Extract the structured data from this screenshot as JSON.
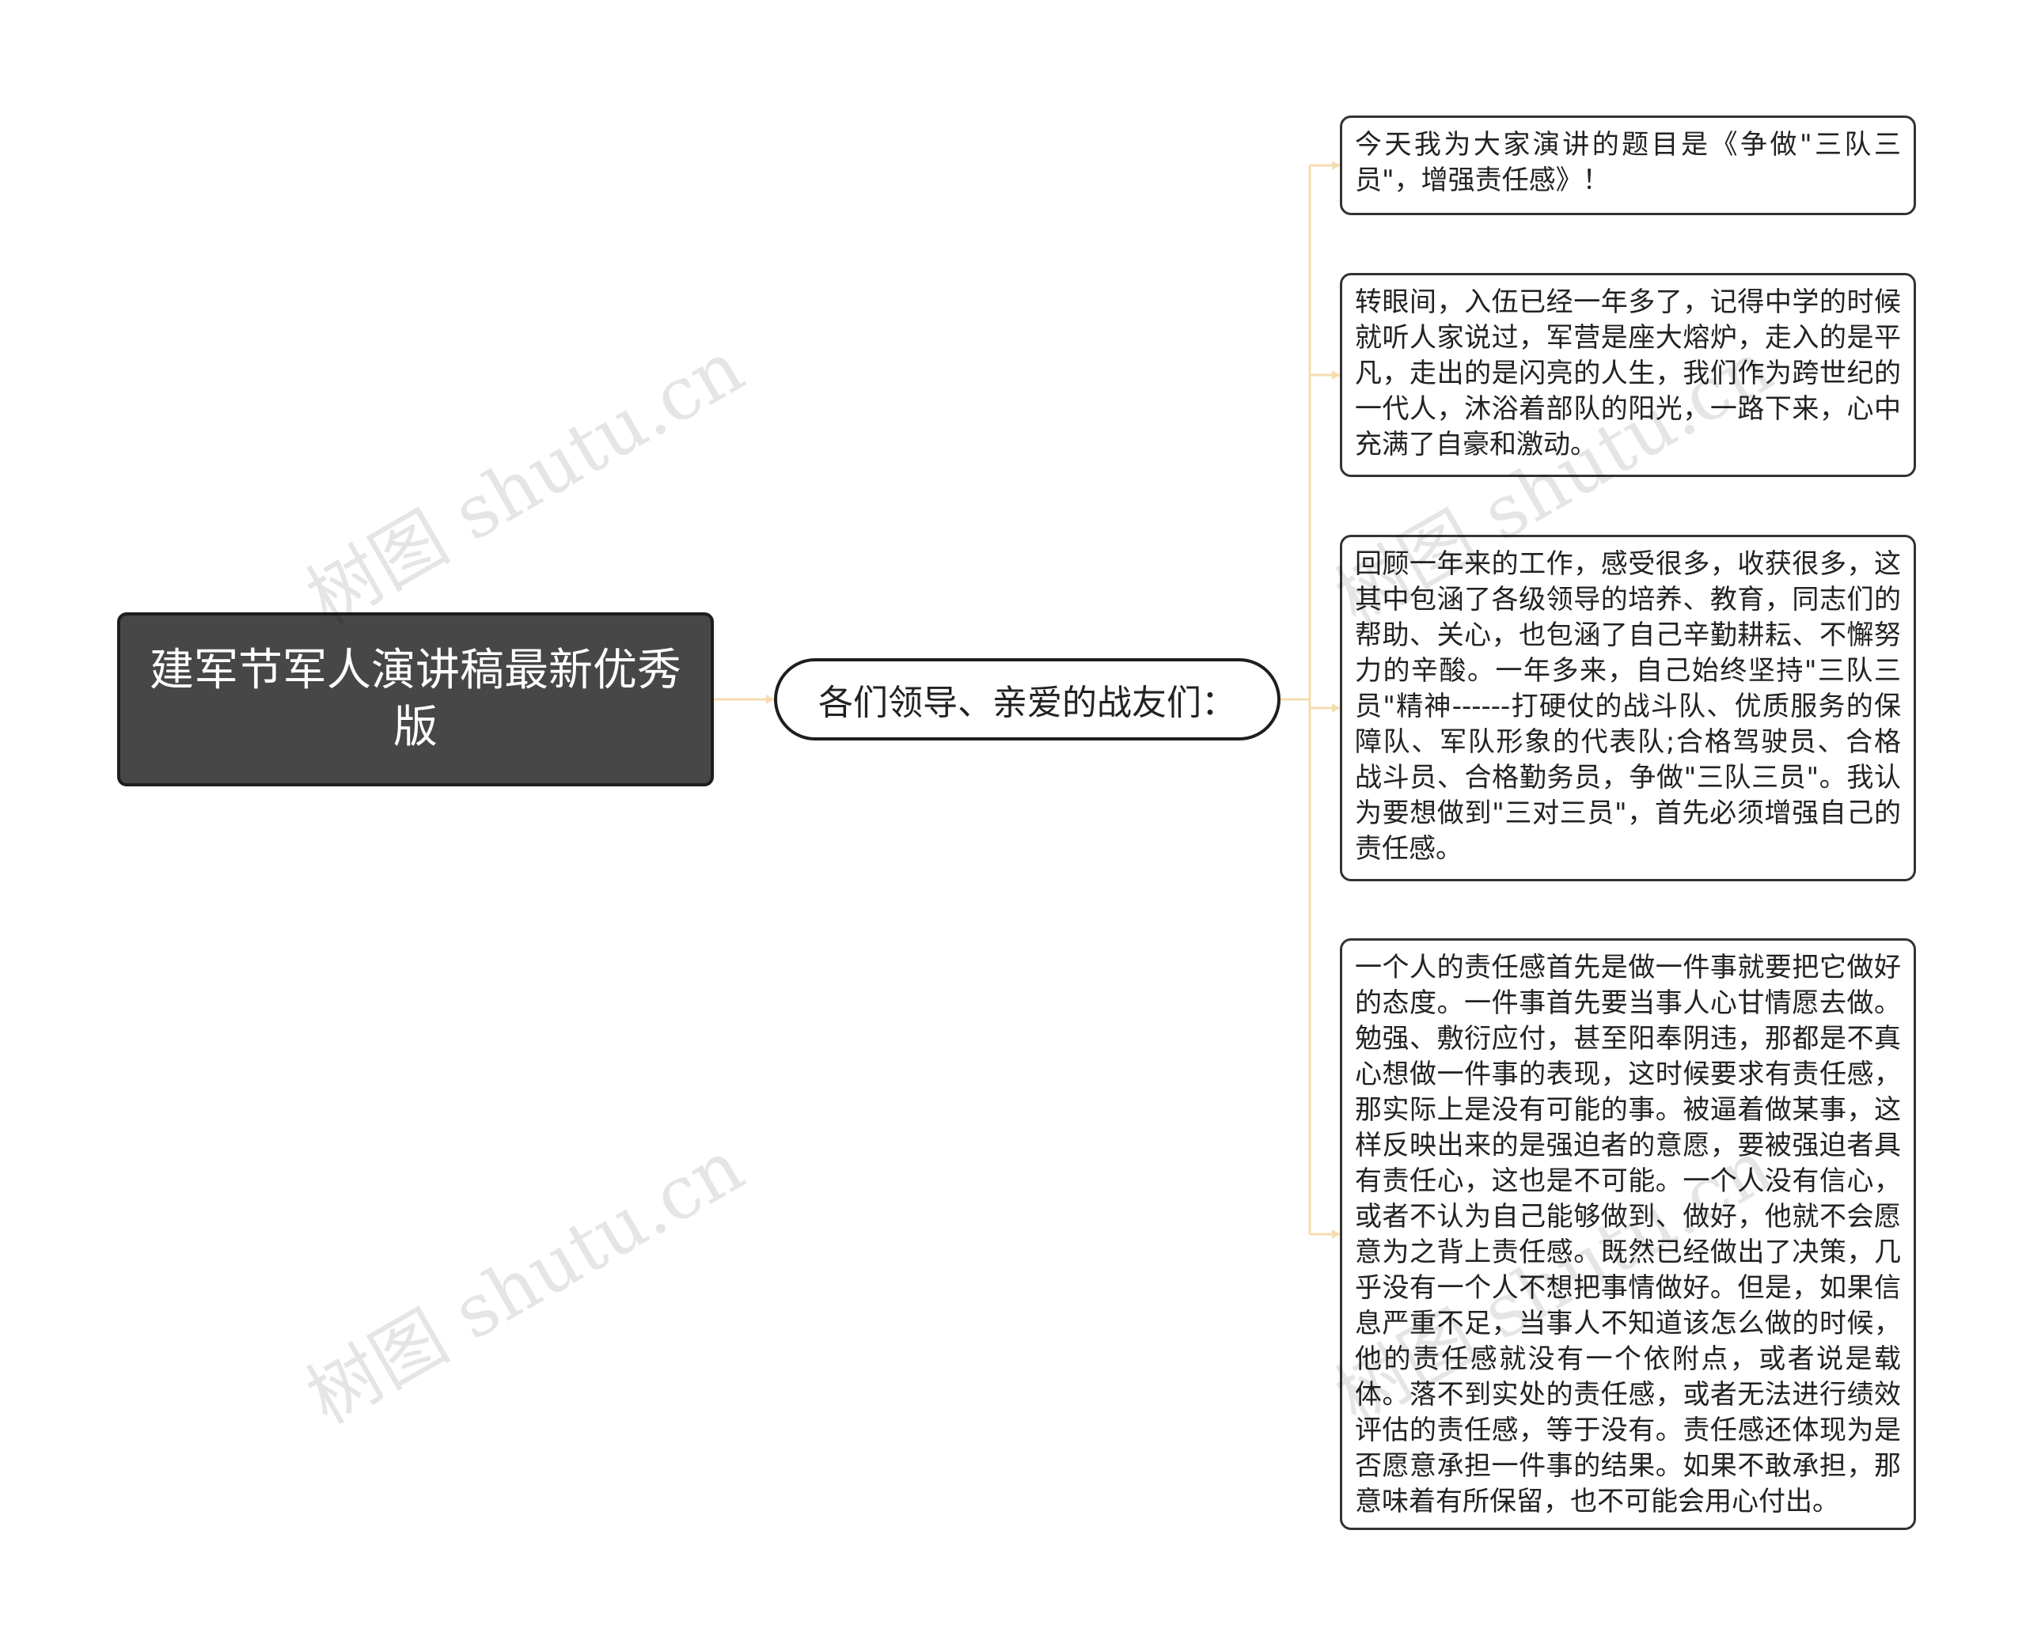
{
  "root": {
    "label": "建军节军人演讲稿最新优秀版"
  },
  "branch": {
    "label": "各们领导、亲爱的战友们："
  },
  "leaves": [
    "今天我为大家演讲的题目是《争做\"三队三员\"，增强责任感》！",
    "转眼间，入伍已经一年多了，记得中学的时候就听人家说过，军营是座大熔炉，走入的是平凡，走出的是闪亮的人生，我们作为跨世纪的一代人，沐浴着部队的阳光，一路下来，心中充满了自豪和激动。",
    "回顾一年来的工作，感受很多，收获很多，这其中包涵了各级领导的培养、教育，同志们的帮助、关心，也包涵了自己辛勤耕耘、不懈努力的辛酸。一年多来，自己始终坚持\"三队三员\"精神------打硬仗的战斗队、优质服务的保障队、军队形象的代表队;合格驾驶员、合格战斗员、合格勤务员，争做\"三队三员\"。我认为要想做到\"三对三员\"，首先必须增强自己的责任感。",
    "一个人的责任感首先是做一件事就要把它做好的态度。一件事首先要当事人心甘情愿去做。勉强、敷衍应付，甚至阳奉阴违，那都是不真心想做一件事的表现，这时候要求有责任感，那实际上是没有可能的事。被逼着做某事，这样反映出来的是强迫者的意愿，要被强迫者具有责任心，这也是不可能。一个人没有信心，或者不认为自己能够做到、做好，他就不会愿意为之背上责任感。既然已经做出了决策，几乎没有一个人不想把事情做好。但是，如果信息严重不足，当事人不知道该怎么做的时候，他的责任感就没有一个依附点，或者说是载体。落不到实处的责任感，或者无法进行绩效评估的责任感，等于没有。责任感还体现为是否愿意承担一件事的结果。如果不敢承担，那意味着有所保留，也不可能会用心付出。"
  ],
  "watermark": {
    "text": "树图 shutu.cn"
  },
  "colors": {
    "connector": "#f5ddb0",
    "root_fill": "#474747",
    "border": "#1e1e1e"
  }
}
